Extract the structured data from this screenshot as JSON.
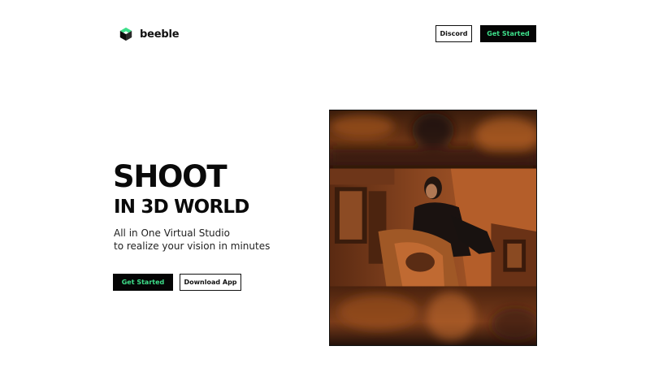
{
  "header": {
    "brand": "beeble",
    "logo_icon": "cube-logo-icon",
    "discord_label": "Discord",
    "get_started_label": "Get Started"
  },
  "hero": {
    "title_line1": "SHOOT",
    "title_line2": "IN 3D WORLD",
    "subtitle_line1": "All in One Virtual Studio",
    "subtitle_line2": "to realize your vision in minutes",
    "primary_cta": "Get Started",
    "secondary_cta": "Download App",
    "media_icon": "virtual-studio-video"
  },
  "colors": {
    "accent": "#3ee08b",
    "button_dark": "#050505",
    "text": "#0a0a0a",
    "background": "#ffffff"
  }
}
